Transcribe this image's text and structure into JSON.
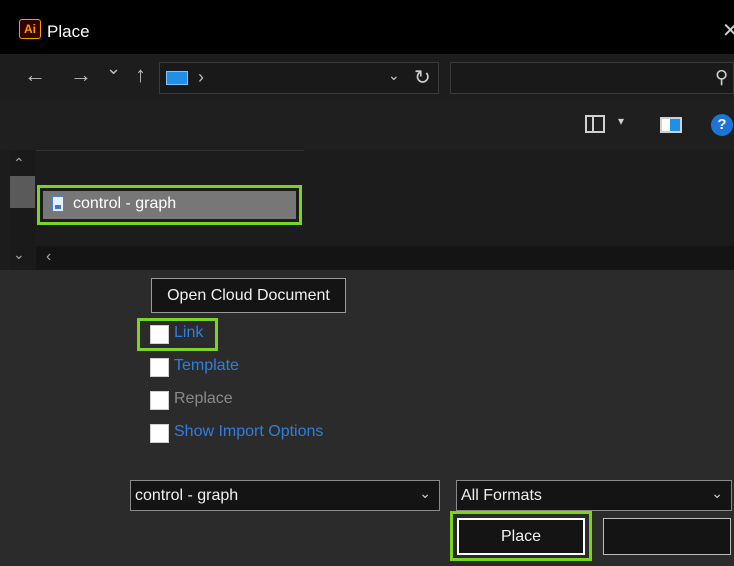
{
  "window": {
    "app_icon_text": "Ai",
    "title": "Place",
    "close_glyph": "✕"
  },
  "navigation": {
    "back_glyph": "←",
    "forward_glyph": "→",
    "recent_glyph": "⌄",
    "up_glyph": "↑",
    "address_arrow": "›",
    "address_dropdown_glyph": "⌄",
    "refresh_glyph": "↻",
    "search_value": "",
    "search_glyph": "⚲"
  },
  "toolbar": {
    "view_dropdown_glyph": "▾",
    "help_label": "?"
  },
  "files": {
    "items": [
      {
        "name": "control - graph",
        "selected": true
      }
    ],
    "scroll_up": "⌃",
    "scroll_down": "⌄",
    "scroll_left": "‹"
  },
  "options": {
    "open_cloud_document": "Open Cloud Document",
    "checkboxes": [
      {
        "label": "Link",
        "checked": false,
        "enabled": true
      },
      {
        "label": "Template",
        "checked": false,
        "enabled": true
      },
      {
        "label": "Replace",
        "checked": false,
        "enabled": false
      },
      {
        "label": "Show Import Options",
        "checked": false,
        "enabled": true
      }
    ]
  },
  "footer": {
    "file_name_value": "control - graph",
    "file_type_value": "All Formats",
    "dropdown_glyph": "⌄",
    "place_button": "Place",
    "cancel_button": ""
  },
  "colors": {
    "highlight": "#7ed321",
    "link_blue": "#2f7fe0",
    "disabled_gray": "#8a8a8a"
  }
}
